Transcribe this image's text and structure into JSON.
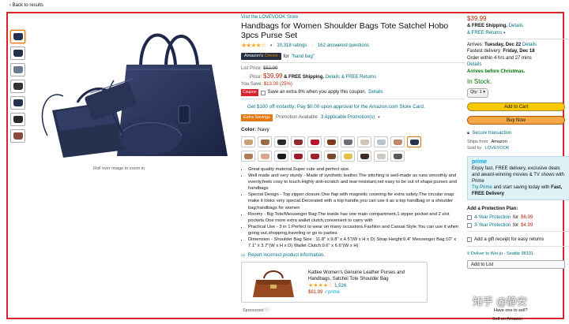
{
  "back_link": "‹ Back to results",
  "roll_over": "Roll over image to zoom in",
  "store": "Visit the LOVEVOOK Store",
  "title": "Handbags for Women Shoulder Bags Tote Satchel Hobo 3pcs Purse Set",
  "rating_count": "10,318 ratings",
  "answered": "162 answered questions",
  "choice_badge_a": "Amazon's",
  "choice_badge_b": "Choice",
  "choice_for": "for",
  "choice_term": "\"hand bag\"",
  "list_price_label": "List Price:",
  "list_price": "$52.99",
  "price_label": "Price:",
  "price": "$39.99",
  "price_shipping": "& FREE Shipping.",
  "details": "Details",
  "free_returns": "& FREE Returns",
  "you_save_label": "You Save:",
  "you_save": "$13.00 (25%)",
  "coupon_badge": "Coupon",
  "coupon_text": "Save an extra 8% when you apply this coupon.",
  "coupon_details": "Details",
  "promo_100": "Get $100 off instantly: Pay $0.00 upon approval for the Amazon.com Store Card.",
  "extra_savings": "Extra Savings",
  "promo_available": "Promotion Available",
  "applicable_promo": "3 Applicable Promotion(s)",
  "color_label": "Color:",
  "color_value": "Navy",
  "swatches": [
    "#c9a27a",
    "#9b6a46",
    "#2a2a2a",
    "#8f2a2f",
    "#b7142b",
    "#7a3b1d",
    "#6b6f74",
    "#d2c6b6",
    "#b9c2cf",
    "#c08968",
    "#26304f",
    "#b07c5a",
    "#d9a38f",
    "#1e1e1e",
    "#9c1b2a",
    "#a31f2b",
    "#7b4a2c",
    "#e2c04a",
    "#3e2b23",
    "#cfc9c2",
    "#5a5a5a"
  ],
  "bullets": [
    "Great quality material,Super cute and perfect size.",
    "Well made and very sturdy - Made of synthetic leather.The stitching is well-made as runs smoothly and evenly,feels cosy to touch.Highly anti-scratch and tear-resistant,not easy to be out of shape;purses and handbags",
    "Special Design - Top zipper closure.One flap with magnetic covering for extra safety.The circular snap make it looks very special.Decorated with a top handle,you can use it as a top handbag or a shoulder bag;handbags for women",
    "Roomy - Big Tote/Messenger Bag:The inside has one main compartment,1 zipper pocket and 2 slot pockets.One more extra wallet clutch,convenient to carry with",
    "Practical Use - 3 in 1:Perfect to wear on many occasions.Fashion and Casual Style.You can use it when going out,shopping,traveling or go to parties",
    "Dimension - Shoulder Bag Size : 11.8\" x 9.8\" x 4.5\"(W x H x D) Strap Height:9.4\" Messenger Bag:10\" x 7.1\" x 3.7\"(W x H x D) Wallet Clutch:9.6\" x 6.6\"(W x H)"
  ],
  "report": "Report incorrect product information.",
  "ad_title": "Kattee Women's Genuine Leather Purses and Handbags, Satchel Tote Shoulder Bag",
  "ad_count": "1,526",
  "ad_price": "$81.99",
  "ad_prime": "✓prime",
  "sponsored": "Sponsored",
  "buy": {
    "price": "$39.99",
    "free_shipping": "& FREE Shipping.",
    "details": "Details",
    "free_returns": "& FREE Returns",
    "arrives_label": "Arrives:",
    "arrives": "Tuesday, Dec 22",
    "arrives_details": "Details",
    "fastest": "Fastest delivery:",
    "fastest_date": "Friday, Dec 18",
    "order_within": "Order within 4 hrs and 27 mins",
    "details2": "Details",
    "arrives_before": "Arrives before Christmas.",
    "in_stock": "In Stock.",
    "qty": "Qty: 1",
    "add_to_cart": "Add to Cart",
    "buy_now": "Buy Now",
    "secure": "Secure transaction",
    "ships_from_label": "Ships from",
    "ships_from": "Amazon",
    "sold_by_label": "Sold by",
    "sold_by": "LOVEVOOK",
    "prime_logo": "prime",
    "prime_1": "Enjoy fast, FREE delivery, exclusive deals and award-winning movies & TV shows with Prime",
    "prime_trial": "Try Prime",
    "prime_2": "and start saving today with",
    "prime_fast": "Fast, FREE Delivery",
    "protection_title": "Add a Protection Plan:",
    "plan1": "4-Year Protection",
    "plan1_for": "for",
    "plan1_price": "$6.99",
    "plan2": "3-Year Protection",
    "plan2_for": "for",
    "plan2_price": "$4.99",
    "gift": "Add a gift receipt for easy returns",
    "deliver_to": "Deliver to Wei-ju - Seattle 98101",
    "add_to_list": "Add to List",
    "sell_1": "Have one to sell?",
    "sell_2": "Sell on Amazon"
  },
  "watermark": "知乎 @静安",
  "colors": {
    "frame": "#d9232d",
    "price": "#b12704",
    "link": "#007185",
    "cart": "#f7ca00",
    "buynow": "#f3a847",
    "stock": "#007600"
  }
}
